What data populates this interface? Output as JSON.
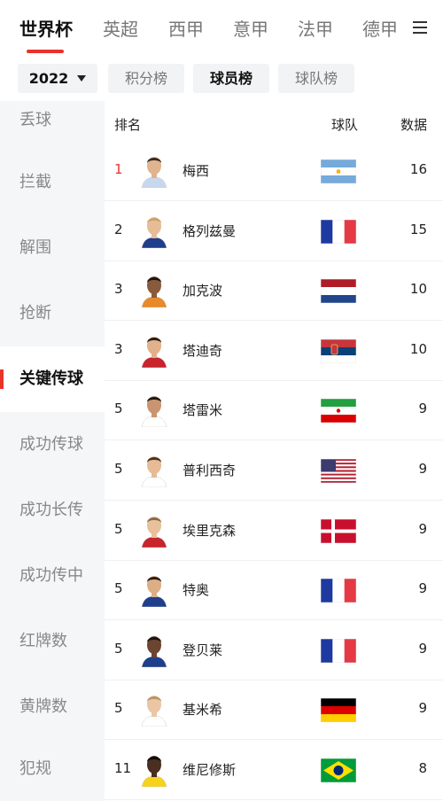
{
  "league_tabs": [
    "世界杯",
    "英超",
    "西甲",
    "意甲",
    "法甲",
    "德甲"
  ],
  "filters": {
    "season": "2022",
    "tabs": [
      "积分榜",
      "球员榜",
      "球队榜"
    ],
    "selected_tab": "球员榜"
  },
  "sidebar": {
    "items": [
      "丢球",
      "拦截",
      "解围",
      "抢断",
      "关键传球",
      "成功传球",
      "成功长传",
      "成功传中",
      "红牌数",
      "黄牌数",
      "犯规"
    ],
    "active": "关键传球"
  },
  "table": {
    "headers": {
      "rank": "排名",
      "team": "球队",
      "value": "数据"
    },
    "rows": [
      {
        "rank": "1",
        "name": "梅西",
        "flag": "argentina",
        "value": "16"
      },
      {
        "rank": "2",
        "name": "格列兹曼",
        "flag": "france",
        "value": "15"
      },
      {
        "rank": "3",
        "name": "加克波",
        "flag": "netherlands",
        "value": "10"
      },
      {
        "rank": "3",
        "name": "塔迪奇",
        "flag": "serbia",
        "value": "10"
      },
      {
        "rank": "5",
        "name": "塔雷米",
        "flag": "iran",
        "value": "9"
      },
      {
        "rank": "5",
        "name": "普利西奇",
        "flag": "usa",
        "value": "9"
      },
      {
        "rank": "5",
        "name": "埃里克森",
        "flag": "denmark",
        "value": "9"
      },
      {
        "rank": "5",
        "name": "特奥",
        "flag": "france",
        "value": "9"
      },
      {
        "rank": "5",
        "name": "登贝莱",
        "flag": "france",
        "value": "9"
      },
      {
        "rank": "5",
        "name": "基米希",
        "flag": "germany",
        "value": "9"
      },
      {
        "rank": "11",
        "name": "维尼修斯",
        "flag": "brazil",
        "value": "8"
      }
    ]
  },
  "colors": {
    "accent": "#e8332a",
    "sidebar_bg": "#f5f6f8",
    "chip_bg": "#f2f3f5"
  }
}
